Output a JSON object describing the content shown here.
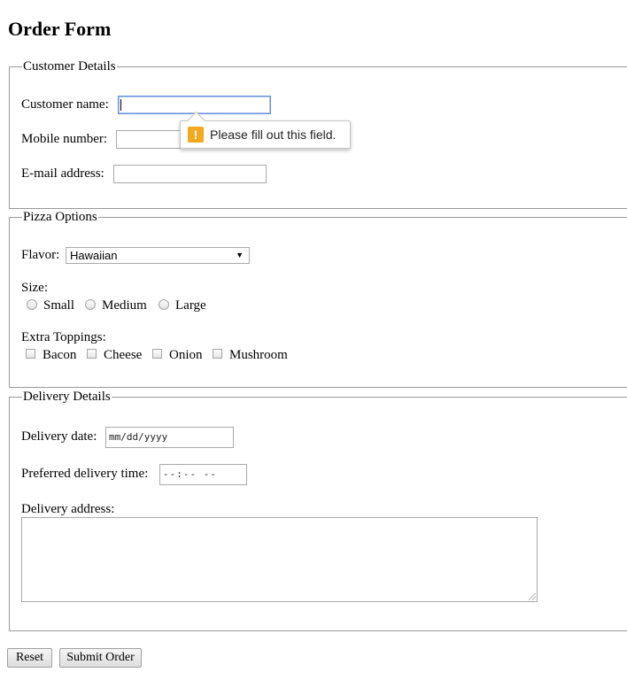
{
  "page": {
    "title": "Order Form"
  },
  "customer": {
    "legend": "Customer Details",
    "name_label": "Customer name:",
    "mobile_label": "Mobile number:",
    "email_label": "E-mail address:",
    "name_value": "",
    "mobile_value": "",
    "email_value": ""
  },
  "tooltip": {
    "icon": "warning-icon",
    "message": "Please fill out this field."
  },
  "pizza": {
    "legend": "Pizza Options",
    "flavor_label": "Flavor:",
    "flavor_selected": "Hawaiian",
    "size_label": "Size:",
    "sizes": [
      "Small",
      "Medium",
      "Large"
    ],
    "toppings_label": "Extra Toppings:",
    "toppings": [
      "Bacon",
      "Cheese",
      "Onion",
      "Mushroom"
    ]
  },
  "delivery": {
    "legend": "Delivery Details",
    "date_label": "Delivery date:",
    "date_placeholder": "mm/dd/yyyy",
    "time_label": "Preferred delivery time:",
    "time_placeholder": "--:-- --",
    "address_label": "Delivery address:"
  },
  "buttons": {
    "reset": "Reset",
    "submit": "Submit Order"
  },
  "colors": {
    "warning": "#f4a920",
    "focus_border": "#6a8fd6"
  }
}
